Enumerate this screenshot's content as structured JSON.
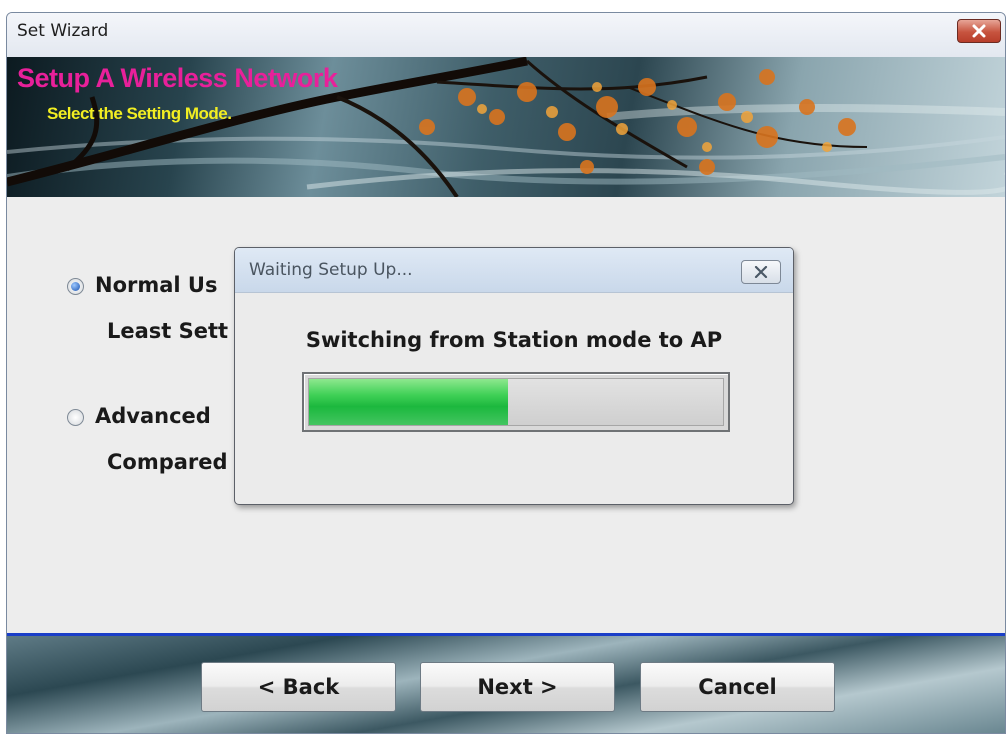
{
  "window": {
    "title": "Set Wizard",
    "close_icon": "close-x-icon"
  },
  "banner": {
    "title": "Setup A Wireless Network",
    "subtitle": "Select the Setting Mode.",
    "title_color": "#e8209a",
    "subtitle_color": "#f2ee22"
  },
  "options": [
    {
      "label": "Normal Us",
      "description": "Least Sett",
      "selected": true
    },
    {
      "label": "Advanced",
      "description": "Compared",
      "selected": false
    }
  ],
  "footer": {
    "back_label": "< Back",
    "next_label": "Next >",
    "cancel_label": "Cancel"
  },
  "dialog": {
    "title": "Waiting Setup Up...",
    "message": "Switching from Station mode to AP",
    "progress": 0.48,
    "close_icon": "close-x-icon"
  },
  "colors": {
    "separator": "#1a3ec8",
    "progress_fill": "#1cb83e"
  }
}
